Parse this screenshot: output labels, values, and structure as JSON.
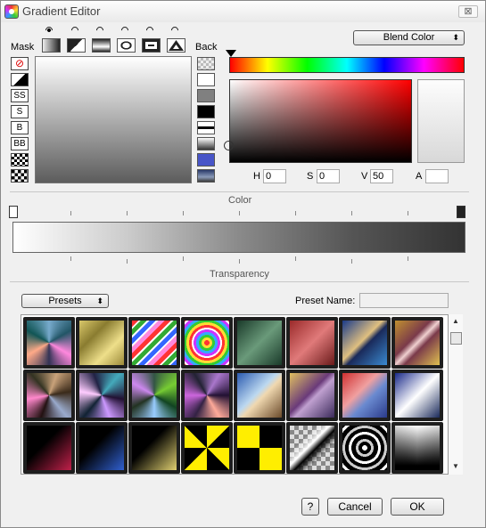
{
  "window": {
    "title": "Gradient Editor",
    "close_label": "⊠"
  },
  "left": {
    "mask_label": "Mask",
    "back_label": "Back"
  },
  "mask_buttons": [
    "⊘",
    "◢",
    "SS",
    "S",
    "B",
    "BB",
    "",
    ""
  ],
  "blend": {
    "label": "Blend Color",
    "arrow": "⬍"
  },
  "hsv": {
    "h_label": "H",
    "h": "0",
    "s_label": "S",
    "s": "0",
    "v_label": "V",
    "v": "50",
    "a_label": "A",
    "a": ""
  },
  "gradient": {
    "color_label": "Color",
    "transparency_label": "Transparency"
  },
  "presets": {
    "button_label": "Presets",
    "arrow": "⬍",
    "name_label": "Preset Name:",
    "name_value": ""
  },
  "scrollbar": {
    "up": "▲",
    "down": "▼"
  },
  "buttons": {
    "help": "?",
    "cancel": "Cancel",
    "ok": "OK"
  }
}
